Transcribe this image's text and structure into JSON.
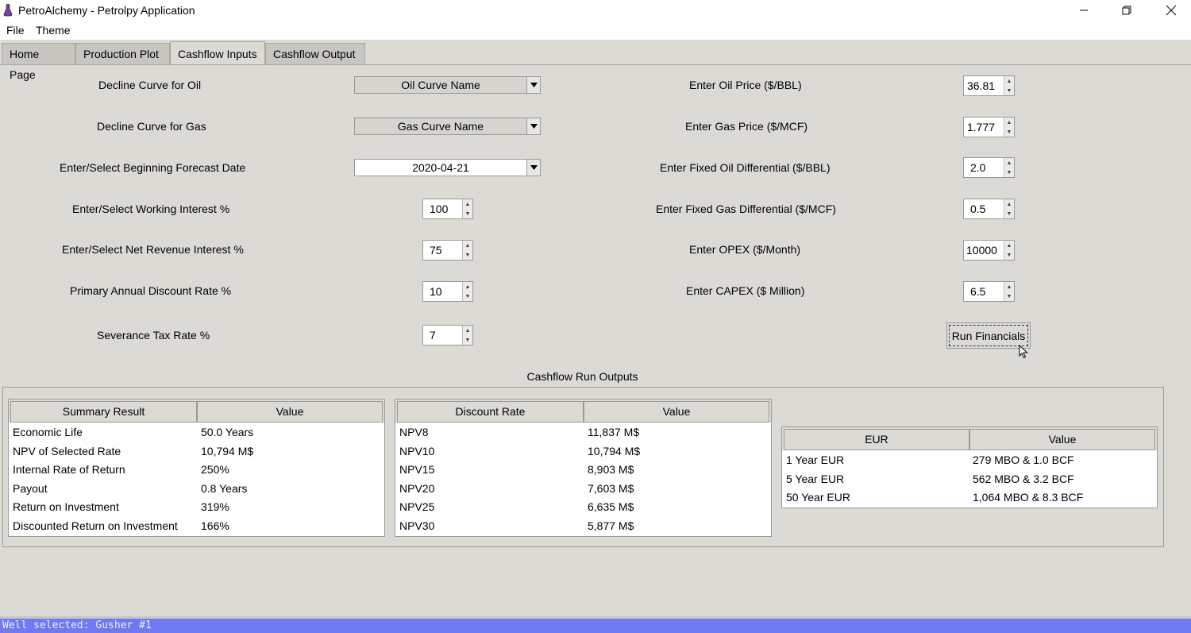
{
  "window": {
    "title": "PetroAlchemy - Petrolpy Application",
    "icon": "flask-icon"
  },
  "menu": [
    "File",
    "Theme"
  ],
  "tabs": [
    "Home Page",
    "Production Plot",
    "Cashflow Inputs",
    "Cashflow Output"
  ],
  "active_tab": "Cashflow Inputs",
  "left_inputs": {
    "oil_curve_label": "Decline Curve for Oil",
    "oil_curve_value": "Oil Curve Name",
    "gas_curve_label": "Decline Curve for Gas",
    "gas_curve_value": "Gas Curve Name",
    "forecast_date_label": "Enter/Select Beginning Forecast Date",
    "forecast_date_value": "2020-04-21",
    "working_interest_label": "Enter/Select Working Interest %",
    "working_interest_value": "100",
    "nri_label": "Enter/Select Net Revenue Interest %",
    "nri_value": "75",
    "discount_label": "Primary Annual Discount Rate %",
    "discount_value": "10",
    "severance_label": "Severance Tax Rate %",
    "severance_value": "7"
  },
  "right_inputs": {
    "oil_price_label": "Enter Oil Price ($/BBL)",
    "oil_price_value": "36.81",
    "gas_price_label": "Enter Gas Price ($/MCF)",
    "gas_price_value": "1.777",
    "oil_diff_label": "Enter Fixed Oil Differential ($/BBL)",
    "oil_diff_value": "2.0",
    "gas_diff_label": "Enter Fixed Gas Differential ($/MCF)",
    "gas_diff_value": "0.5",
    "opex_label": "Enter OPEX ($/Month)",
    "opex_value": "10000",
    "capex_label": "Enter CAPEX ($ Million)",
    "capex_value": "6.5"
  },
  "run_button": "Run Financials",
  "outputs_title": "Cashflow Run Outputs",
  "summary_table": {
    "headers": [
      "Summary Result",
      "Value"
    ],
    "rows": [
      [
        "Economic Life",
        "50.0 Years"
      ],
      [
        "NPV of Selected Rate",
        "10,794 M$"
      ],
      [
        "Internal Rate of Return",
        "250%"
      ],
      [
        "Payout",
        "0.8 Years"
      ],
      [
        "Return on Investment",
        "319%"
      ],
      [
        "Discounted Return on Investment",
        "166%"
      ]
    ]
  },
  "discount_table": {
    "headers": [
      "Discount Rate",
      "Value"
    ],
    "rows": [
      [
        "NPV8",
        "11,837 M$"
      ],
      [
        "NPV10",
        "10,794 M$"
      ],
      [
        "NPV15",
        "8,903 M$"
      ],
      [
        "NPV20",
        "7,603 M$"
      ],
      [
        "NPV25",
        "6,635 M$"
      ],
      [
        "NPV30",
        "5,877 M$"
      ]
    ]
  },
  "eur_table": {
    "headers": [
      "EUR",
      "Value"
    ],
    "rows": [
      [
        "1 Year EUR",
        "279 MBO & 1.0 BCF"
      ],
      [
        "5 Year EUR",
        "562 MBO & 3.2 BCF"
      ],
      [
        "50 Year EUR",
        "1,064 MBO & 8.3 BCF"
      ]
    ]
  },
  "status": "Well selected: Gusher #1",
  "colors": {
    "window_bg": "#dcdad5",
    "status_bar": "#6f79f0"
  }
}
